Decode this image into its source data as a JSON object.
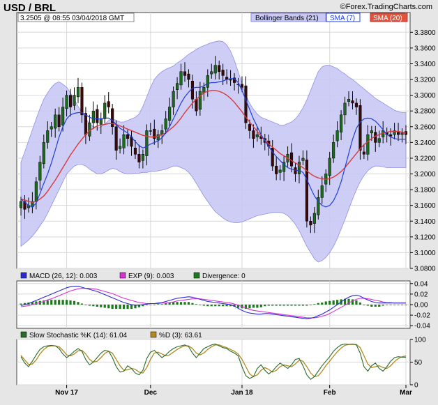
{
  "header": {
    "symbol": "USD / BRL",
    "quote": "3.2505 @ 08:55  03/04/2018 GMT",
    "source": "©Forex.TradingCharts.com"
  },
  "colors": {
    "band_fill": "#c8c8f4",
    "band_line": "#8f8fe6",
    "sma_fast": "#1f3fd6",
    "sma_slow": "#d83a3a",
    "up_candle": "#1c6b1c",
    "down_candle": "#3a0a0a",
    "macd": "#2a2ad0",
    "exp": "#d632d6",
    "divergence": "#1c7a1c",
    "stoch_k": "#2a6a2a",
    "stoch_d": "#b08a20"
  },
  "chart_data": [
    {
      "type": "candlestick",
      "title": "USD / BRL",
      "legend": [
        "Bollinger Bands (21)",
        "SMA (7)",
        "SMA (20)"
      ],
      "ylim": [
        3.08,
        3.39
      ],
      "yticks": [
        "3.3800",
        "3.3600",
        "3.3400",
        "3.3200",
        "3.3000",
        "3.2800",
        "3.2600",
        "3.2400",
        "3.2200",
        "3.2000",
        "3.1800",
        "3.1600",
        "3.1400",
        "3.1200",
        "3.1000",
        "3.0800"
      ],
      "x_labels": [
        "Nov 17",
        "Dec",
        "Jan 18",
        "Feb",
        "Mar"
      ],
      "x_label_index": [
        12,
        34,
        58,
        81,
        101
      ],
      "close": [
        3.165,
        3.155,
        3.16,
        3.165,
        3.19,
        3.215,
        3.24,
        3.255,
        3.26,
        3.275,
        3.26,
        3.285,
        3.3,
        3.285,
        3.3,
        3.31,
        3.275,
        3.25,
        3.265,
        3.28,
        3.265,
        3.27,
        3.29,
        3.285,
        3.26,
        3.23,
        3.235,
        3.25,
        3.245,
        3.235,
        3.225,
        3.215,
        3.225,
        3.255,
        3.255,
        3.245,
        3.25,
        3.255,
        3.27,
        3.285,
        3.305,
        3.315,
        3.33,
        3.325,
        3.32,
        3.295,
        3.28,
        3.305,
        3.31,
        3.325,
        3.33,
        3.338,
        3.33,
        3.325,
        3.32,
        3.32,
        3.316,
        3.314,
        3.31,
        3.265,
        3.255,
        3.245,
        3.25,
        3.245,
        3.24,
        3.235,
        3.21,
        3.2,
        3.205,
        3.215,
        3.225,
        3.21,
        3.2,
        3.215,
        3.22,
        3.14,
        3.135,
        3.15,
        3.17,
        3.185,
        3.2,
        3.22,
        3.24,
        3.255,
        3.275,
        3.29,
        3.295,
        3.29,
        3.285,
        3.23,
        3.225,
        3.25,
        3.255,
        3.24,
        3.245,
        3.255,
        3.25,
        3.248,
        3.255,
        3.25,
        3.252,
        3.25
      ],
      "bollinger_upper": [
        3.215,
        3.228,
        3.242,
        3.256,
        3.27,
        3.283,
        3.295,
        3.303,
        3.31,
        3.315,
        3.317,
        3.314,
        3.31,
        3.303,
        3.295,
        3.286,
        3.278,
        3.27,
        3.264,
        3.26,
        3.258,
        3.26,
        3.263,
        3.268,
        3.27,
        3.268,
        3.266,
        3.266,
        3.268,
        3.27,
        3.272,
        3.276,
        3.286,
        3.298,
        3.31,
        3.32,
        3.326,
        3.33,
        3.333,
        3.335,
        3.337,
        3.341,
        3.344,
        3.348,
        3.352,
        3.355,
        3.358,
        3.361,
        3.363,
        3.365,
        3.367,
        3.368,
        3.369,
        3.368,
        3.364,
        3.356,
        3.344,
        3.33,
        3.315,
        3.3,
        3.29,
        3.282,
        3.276,
        3.272,
        3.27,
        3.268,
        3.266,
        3.264,
        3.262,
        3.262,
        3.264,
        3.266,
        3.27,
        3.276,
        3.284,
        3.294,
        3.306,
        3.318,
        3.33,
        3.336,
        3.338,
        3.338,
        3.336,
        3.334,
        3.33,
        3.327,
        3.323,
        3.32,
        3.316,
        3.312,
        3.308,
        3.304,
        3.3,
        3.296,
        3.293,
        3.29,
        3.287,
        3.284,
        3.281,
        3.279,
        3.278,
        3.278
      ],
      "bollinger_lower": [
        3.108,
        3.112,
        3.116,
        3.121,
        3.127,
        3.134,
        3.141,
        3.15,
        3.16,
        3.17,
        3.18,
        3.19,
        3.2,
        3.205,
        3.21,
        3.212,
        3.212,
        3.21,
        3.206,
        3.203,
        3.2,
        3.2,
        3.202,
        3.205,
        3.207,
        3.206,
        3.203,
        3.201,
        3.2,
        3.2,
        3.201,
        3.201,
        3.202,
        3.202,
        3.203,
        3.203,
        3.204,
        3.205,
        3.206,
        3.208,
        3.21,
        3.21,
        3.208,
        3.206,
        3.202,
        3.196,
        3.188,
        3.18,
        3.172,
        3.165,
        3.158,
        3.152,
        3.148,
        3.144,
        3.141,
        3.139,
        3.138,
        3.138,
        3.139,
        3.141,
        3.143,
        3.145,
        3.147,
        3.148,
        3.149,
        3.15,
        3.151,
        3.151,
        3.151,
        3.15,
        3.147,
        3.142,
        3.136,
        3.128,
        3.118,
        3.108,
        3.1,
        3.092,
        3.088,
        3.09,
        3.094,
        3.1,
        3.108,
        3.118,
        3.13,
        3.142,
        3.155,
        3.168,
        3.18,
        3.19,
        3.198,
        3.204,
        3.208,
        3.21,
        3.21,
        3.209,
        3.208,
        3.208,
        3.208,
        3.208,
        3.208,
        3.208
      ],
      "sma_7": [
        3.168,
        3.164,
        3.16,
        3.158,
        3.163,
        3.175,
        3.188,
        3.2,
        3.214,
        3.23,
        3.247,
        3.26,
        3.27,
        3.275,
        3.277,
        3.278,
        3.278,
        3.275,
        3.272,
        3.27,
        3.27,
        3.27,
        3.271,
        3.271,
        3.268,
        3.263,
        3.258,
        3.255,
        3.252,
        3.247,
        3.241,
        3.236,
        3.233,
        3.235,
        3.238,
        3.24,
        3.242,
        3.246,
        3.252,
        3.26,
        3.27,
        3.28,
        3.29,
        3.298,
        3.304,
        3.309,
        3.31,
        3.31,
        3.312,
        3.315,
        3.316,
        3.316,
        3.317,
        3.318,
        3.32,
        3.321,
        3.321,
        3.316,
        3.306,
        3.294,
        3.282,
        3.27,
        3.26,
        3.25,
        3.242,
        3.235,
        3.228,
        3.222,
        3.217,
        3.212,
        3.208,
        3.206,
        3.205,
        3.204,
        3.202,
        3.193,
        3.182,
        3.172,
        3.165,
        3.16,
        3.158,
        3.16,
        3.166,
        3.176,
        3.19,
        3.208,
        3.226,
        3.244,
        3.258,
        3.266,
        3.27,
        3.271,
        3.27,
        3.267,
        3.262,
        3.256,
        3.25,
        3.247,
        3.245,
        3.244,
        3.244,
        3.244
      ],
      "sma_20": [
        3.168,
        3.167,
        3.165,
        3.164,
        3.165,
        3.168,
        3.172,
        3.178,
        3.185,
        3.192,
        3.2,
        3.208,
        3.216,
        3.224,
        3.231,
        3.238,
        3.244,
        3.25,
        3.255,
        3.258,
        3.261,
        3.262,
        3.263,
        3.264,
        3.264,
        3.263,
        3.261,
        3.259,
        3.257,
        3.255,
        3.253,
        3.251,
        3.249,
        3.248,
        3.247,
        3.247,
        3.248,
        3.25,
        3.252,
        3.256,
        3.26,
        3.265,
        3.271,
        3.278,
        3.284,
        3.29,
        3.295,
        3.299,
        3.303,
        3.305,
        3.306,
        3.306,
        3.305,
        3.303,
        3.3,
        3.296,
        3.291,
        3.285,
        3.279,
        3.272,
        3.266,
        3.26,
        3.254,
        3.248,
        3.243,
        3.238,
        3.234,
        3.23,
        3.226,
        3.223,
        3.22,
        3.217,
        3.214,
        3.211,
        3.208,
        3.204,
        3.2,
        3.197,
        3.195,
        3.194,
        3.193,
        3.194,
        3.196,
        3.199,
        3.203,
        3.208,
        3.214,
        3.22,
        3.226,
        3.232,
        3.237,
        3.241,
        3.245,
        3.248,
        3.25,
        3.252,
        3.253,
        3.254,
        3.254,
        3.254,
        3.253,
        3.252
      ]
    },
    {
      "type": "bar",
      "title": "MACD (26, 12): 0.003",
      "legend": [
        "MACD (26, 12): 0.003",
        "EXP (9): 0.003",
        "Divergence: 0"
      ],
      "ylim": [
        -0.045,
        0.045
      ],
      "yticks": [
        "0.04",
        "0.02",
        "0.00",
        "-0.02",
        "-0.04"
      ],
      "macd": [
        -0.002,
        0.0,
        0.002,
        0.005,
        0.008,
        0.011,
        0.014,
        0.017,
        0.02,
        0.023,
        0.026,
        0.029,
        0.032,
        0.034,
        0.035,
        0.035,
        0.033,
        0.031,
        0.029,
        0.027,
        0.025,
        0.022,
        0.019,
        0.016,
        0.013,
        0.01,
        0.007,
        0.004,
        0.002,
        0.0,
        -0.001,
        -0.001,
        0.0,
        0.001,
        0.002,
        0.002,
        0.003,
        0.004,
        0.006,
        0.008,
        0.01,
        0.012,
        0.013,
        0.014,
        0.015,
        0.014,
        0.012,
        0.01,
        0.008,
        0.006,
        0.005,
        0.004,
        0.003,
        0.002,
        0.001,
        0.0,
        -0.003,
        -0.007,
        -0.011,
        -0.014,
        -0.016,
        -0.017,
        -0.018,
        -0.018,
        -0.017,
        -0.017,
        -0.018,
        -0.019,
        -0.02,
        -0.021,
        -0.022,
        -0.023,
        -0.024,
        -0.025,
        -0.026,
        -0.027,
        -0.026,
        -0.024,
        -0.021,
        -0.018,
        -0.014,
        -0.01,
        -0.005,
        0.0,
        0.005,
        0.01,
        0.014,
        0.017,
        0.018,
        0.016,
        0.012,
        0.009,
        0.006,
        0.004,
        0.003,
        0.003,
        0.003,
        0.003,
        0.003,
        0.003,
        0.003,
        0.003
      ],
      "exp": [
        -0.004,
        -0.003,
        -0.002,
        0.0,
        0.002,
        0.004,
        0.006,
        0.009,
        0.011,
        0.014,
        0.017,
        0.02,
        0.023,
        0.026,
        0.028,
        0.03,
        0.031,
        0.031,
        0.031,
        0.03,
        0.029,
        0.027,
        0.025,
        0.023,
        0.021,
        0.018,
        0.015,
        0.012,
        0.01,
        0.008,
        0.006,
        0.004,
        0.003,
        0.002,
        0.002,
        0.002,
        0.002,
        0.003,
        0.003,
        0.004,
        0.005,
        0.007,
        0.008,
        0.009,
        0.01,
        0.011,
        0.011,
        0.011,
        0.01,
        0.009,
        0.008,
        0.007,
        0.006,
        0.005,
        0.004,
        0.003,
        0.001,
        -0.001,
        -0.004,
        -0.006,
        -0.009,
        -0.011,
        -0.012,
        -0.013,
        -0.014,
        -0.015,
        -0.016,
        -0.017,
        -0.018,
        -0.019,
        -0.02,
        -0.021,
        -0.022,
        -0.023,
        -0.024,
        -0.025,
        -0.025,
        -0.025,
        -0.024,
        -0.022,
        -0.02,
        -0.017,
        -0.013,
        -0.009,
        -0.005,
        -0.001,
        0.003,
        0.007,
        0.01,
        0.012,
        0.012,
        0.011,
        0.01,
        0.008,
        0.007,
        0.005,
        0.004,
        0.004,
        0.003,
        0.003,
        0.003,
        0.003
      ],
      "divergence": [
        0.002,
        0.003,
        0.004,
        0.005,
        0.006,
        0.007,
        0.008,
        0.008,
        0.009,
        0.009,
        0.009,
        0.009,
        0.009,
        0.008,
        0.007,
        0.005,
        0.002,
        0.0,
        -0.002,
        -0.003,
        -0.004,
        -0.005,
        -0.006,
        -0.007,
        -0.008,
        -0.008,
        -0.008,
        -0.008,
        -0.008,
        -0.008,
        -0.007,
        -0.005,
        -0.003,
        -0.001,
        0.0,
        0.0,
        0.001,
        0.001,
        0.003,
        0.004,
        0.005,
        0.005,
        0.005,
        0.005,
        0.005,
        0.003,
        0.001,
        -0.001,
        -0.002,
        -0.003,
        -0.003,
        -0.003,
        -0.003,
        -0.003,
        -0.003,
        -0.003,
        -0.004,
        -0.006,
        -0.007,
        -0.008,
        -0.007,
        -0.006,
        -0.006,
        -0.005,
        -0.003,
        -0.002,
        -0.002,
        -0.002,
        -0.002,
        -0.002,
        -0.002,
        -0.002,
        -0.002,
        -0.002,
        -0.002,
        -0.002,
        -0.001,
        0.001,
        0.003,
        0.004,
        0.006,
        0.007,
        0.008,
        0.009,
        0.01,
        0.011,
        0.011,
        0.01,
        0.008,
        0.004,
        0.0,
        -0.002,
        -0.004,
        -0.004,
        -0.004,
        -0.002,
        -0.001,
        -0.001,
        0.0,
        0.0,
        0.0,
        0.0
      ]
    },
    {
      "type": "line",
      "title": "Slow Stochastic %K (14): 61.04",
      "legend": [
        "Slow Stochastic %K (14): 61.04",
        "%D (3): 63.61"
      ],
      "ylim": [
        0,
        100
      ],
      "yticks": [
        "100",
        "50",
        "0"
      ],
      "k": [
        62,
        48,
        40,
        52,
        66,
        78,
        84,
        86,
        87,
        86,
        80,
        68,
        60,
        66,
        74,
        80,
        74,
        56,
        44,
        50,
        60,
        70,
        76,
        74,
        60,
        40,
        28,
        30,
        42,
        36,
        26,
        22,
        32,
        58,
        72,
        76,
        68,
        60,
        66,
        74,
        80,
        84,
        86,
        88,
        84,
        70,
        60,
        70,
        80,
        84,
        88,
        90,
        86,
        82,
        80,
        74,
        70,
        64,
        40,
        20,
        14,
        18,
        36,
        44,
        32,
        24,
        30,
        40,
        48,
        42,
        36,
        44,
        56,
        58,
        42,
        22,
        12,
        18,
        30,
        42,
        52,
        62,
        74,
        82,
        88,
        90,
        89,
        90,
        88,
        70,
        40,
        30,
        42,
        48,
        36,
        30,
        40,
        52,
        60,
        62,
        61,
        61
      ],
      "d": [
        65,
        55,
        45,
        46,
        55,
        68,
        78,
        84,
        86,
        86,
        84,
        76,
        66,
        64,
        68,
        75,
        76,
        68,
        56,
        50,
        52,
        60,
        69,
        74,
        70,
        56,
        42,
        32,
        33,
        36,
        34,
        28,
        26,
        38,
        56,
        70,
        72,
        68,
        64,
        66,
        72,
        78,
        83,
        86,
        86,
        80,
        70,
        66,
        70,
        78,
        84,
        88,
        88,
        85,
        82,
        78,
        74,
        68,
        56,
        40,
        24,
        18,
        22,
        32,
        38,
        34,
        28,
        32,
        40,
        44,
        42,
        40,
        46,
        54,
        52,
        40,
        26,
        18,
        20,
        30,
        42,
        52,
        63,
        73,
        81,
        87,
        89,
        89,
        89,
        82,
        64,
        46,
        38,
        40,
        42,
        38,
        36,
        42,
        51,
        58,
        62,
        63.61
      ]
    }
  ],
  "panels": {
    "price_legend": {
      "bb": "Bollinger Bands (21)",
      "sma7": "SMA (7)",
      "sma20": "SMA (20)"
    },
    "macd_legend": {
      "macd": "MACD (26, 12): 0.003",
      "exp": "EXP (9): 0.003",
      "div": "Divergence: 0"
    },
    "stoch_legend": {
      "k": "Slow Stochastic %K (14): 61.04",
      "d": "%D (3): 63.61"
    }
  }
}
